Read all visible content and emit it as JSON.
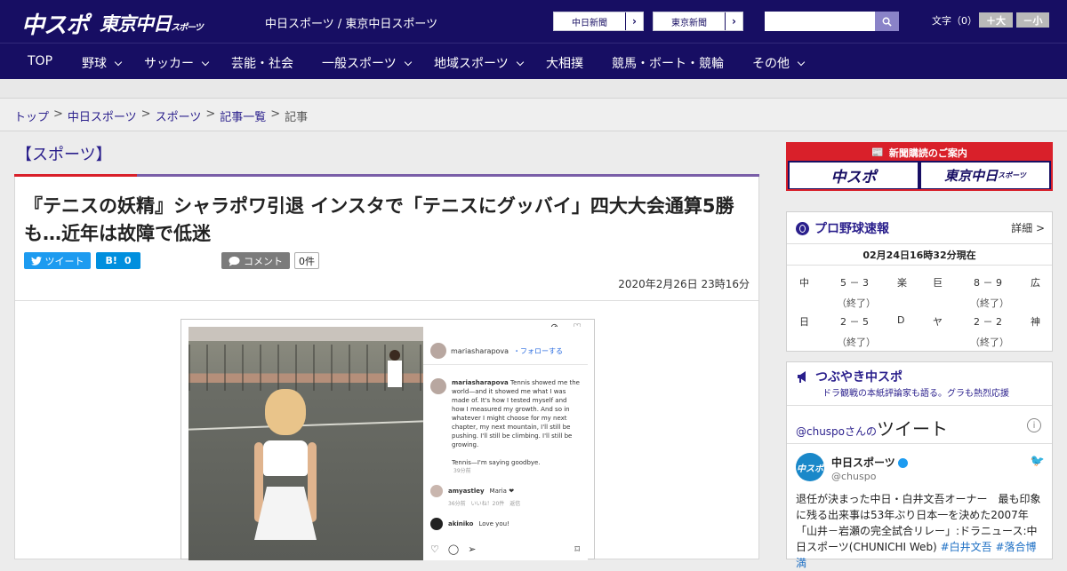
{
  "header": {
    "logo_main": "中スポ",
    "logo_tokyo": "東京中日",
    "logo_tokyo_sub": "スポーツ",
    "tagline": "中日スポーツ / 東京中日スポーツ",
    "btn_chunichi": "中日新聞",
    "btn_tokyo": "東京新聞",
    "search_placeholder": "",
    "font_label": "文字（0）",
    "font_plus": "＋大",
    "font_minus": "－小"
  },
  "nav": {
    "items": [
      {
        "label": "TOP",
        "has_menu": false
      },
      {
        "label": "野球",
        "has_menu": true
      },
      {
        "label": "サッカー",
        "has_menu": true
      },
      {
        "label": "芸能・社会",
        "has_menu": false
      },
      {
        "label": "一般スポーツ",
        "has_menu": true
      },
      {
        "label": "地域スポーツ",
        "has_menu": true
      },
      {
        "label": "大相撲",
        "has_menu": false
      },
      {
        "label": "競馬・ボート・競輪",
        "has_menu": false
      },
      {
        "label": "その他",
        "has_menu": true
      }
    ]
  },
  "breadcrumb": {
    "items": [
      "トップ",
      "中日スポーツ",
      "スポーツ",
      "記事一覧",
      "記事"
    ],
    "sep": ">"
  },
  "article": {
    "section": "【スポーツ】",
    "headline": "『テニスの妖精』シャラポワ引退 インスタで「テニスにグッバイ」四大大会通算5勝も…近年は故障で低迷",
    "tweet_label": "ツイート",
    "hatena_label": "B!",
    "hatena_count": "0",
    "comment_label": "コメント",
    "comment_count": "0件",
    "date": "2020年2月26日 23時16分"
  },
  "instagram": {
    "username": "mariasharapova",
    "follow": "・フォローする",
    "caption": "Tennis showed me the world—and it showed me what I was made of. It's how I tested myself and how I measured my growth. And so in whatever I might choose for my next chapter, my next mountain, I'll still be pushing. I'll still be climbing. I'll still be growing.",
    "caption2": "Tennis—I'm saying goodbye.",
    "time": "39分前",
    "c1_user": "amyastley",
    "c1_text": "Maria ❤",
    "c1_meta": "36分前　いいね！20件　返信",
    "c2_user": "akiniko",
    "c2_text": "Love you!"
  },
  "sidebar": {
    "subscribe_header": "新聞購読のご案内",
    "sub_chuspo": "中スポ",
    "sub_tokyo": "東京中日",
    "sub_tokyo_small": "スポーツ",
    "baseball_title": "プロ野球速報",
    "baseball_more": "詳細 >",
    "baseball_time": "02月24日16時32分現在",
    "games": [
      {
        "a": "中",
        "score": "5 － 3",
        "b": "楽",
        "status": "（終了）"
      },
      {
        "a": "巨",
        "score": "8 － 9",
        "b": "広",
        "status": "（終了）"
      },
      {
        "a": "日",
        "score": "2 － 5",
        "b": "D",
        "status": "（終了）"
      },
      {
        "a": "ヤ",
        "score": "2 － 2",
        "b": "神",
        "status": "（終了）"
      }
    ],
    "tweet_title": "つぶやき中スポ",
    "tweet_sub": "ドラ観戦の本紙評論家も語る。グラも熱烈応援",
    "tweet_handle_link": "@chuspo",
    "tweet_san": "さんの",
    "tweet_word": "ツイート",
    "tw_name": "中日スポーツ",
    "tw_handle": "@chuspo",
    "tw_avatar": "中スポ",
    "tw_text": "退任が決まった中日・白井文吾オーナー　最も印象に残る出来事は53年ぶり日本一を決めた2007年「山井－岩瀬の完全試合リレー」:ドラニュース:中日スポーツ(CHUNICHI Web)",
    "tw_hash1": "#白井文吾",
    "tw_hash2": "#落合博満"
  },
  "colors": {
    "brand": "#170e63",
    "accent_red": "#d9202a",
    "link": "#2a1f8c",
    "twitter": "#1d9bf0"
  }
}
